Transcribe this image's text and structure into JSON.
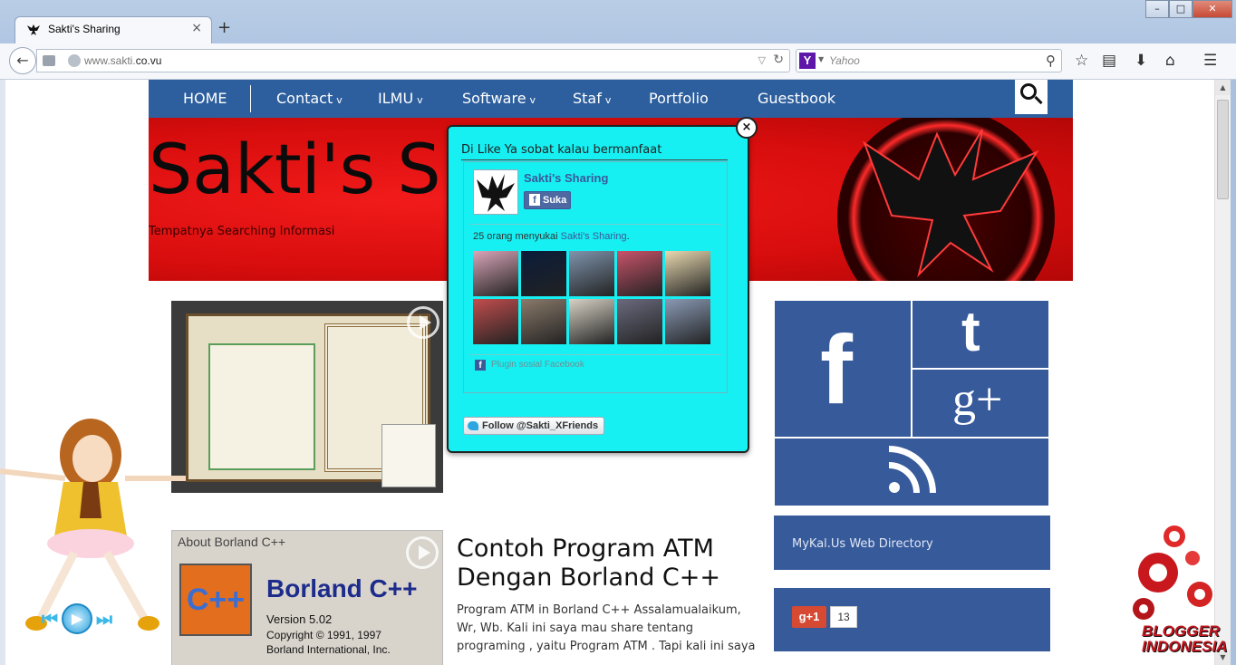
{
  "browser": {
    "tab_title": "Sakti's Sharing",
    "tab_close": "×",
    "new_tab": "+",
    "url_prefix": "www.sakti.",
    "url_domain": "co.vu",
    "search_engine": "Yahoo",
    "window_controls": {
      "minimize": "–",
      "maximize": "□",
      "close": "✕"
    }
  },
  "nav": {
    "items": [
      {
        "label": "HOME",
        "caret": ""
      },
      {
        "label": "Contact",
        "caret": "v"
      },
      {
        "label": "ILMU",
        "caret": "v"
      },
      {
        "label": "Software",
        "caret": "v"
      },
      {
        "label": "Staf",
        "caret": "v"
      },
      {
        "label": "Portfolio",
        "caret": ""
      },
      {
        "label": "Guestbook",
        "caret": ""
      }
    ]
  },
  "header": {
    "title": "Sakti's S",
    "tagline": "Tempatnya Searching Informasi"
  },
  "popup": {
    "heading": "Di Like Ya sobat kalau bermanfaat",
    "page_name": "Sakti's Sharing",
    "like_button": "Suka",
    "likes_prefix": "25 orang menyukai ",
    "likes_page": "Sakti's Sharing",
    "likes_suffix": ".",
    "plugin_text": "Plugin sosial Facebook",
    "follow_button": "Follow @Sakti_XFriends",
    "close": "×",
    "faces": [
      "#d9a5b8",
      "#0a1c3a",
      "#7f94ad",
      "#c9536a",
      "#e9d9b0",
      "#c24d4d",
      "#8a7a6a",
      "#d7d2c5",
      "#6a6a7e",
      "#8a9ab5"
    ]
  },
  "post2": {
    "thumb_caption": "About Borland C++",
    "thumb_logo": "C++",
    "thumb_brand": "Borland C++",
    "thumb_version": "Version 5.02",
    "thumb_copyright1": "Copyright © 1991, 1997",
    "thumb_copyright2": "Borland International, Inc.",
    "title": "Contoh Program ATM Dengan Borland C++",
    "excerpt": "Program ATM in Borland C++ Assalamualaikum, Wr, Wb. Kali ini saya mau share tentang programing , yaitu Program ATM . Tapi kali ini saya"
  },
  "sidebar": {
    "social": {
      "facebook_glyph": "f",
      "twitter_glyph": "t",
      "googleplus_glyph": "g+"
    },
    "directory_link": "MyKal.Us Web Directory",
    "gplus_button": "g+1",
    "gplus_count": "13"
  },
  "player": {
    "prev": "⏮",
    "play": "▶",
    "next": "⏭"
  },
  "badge": {
    "line1": "BLOGGER",
    "line2": "INDONESIA"
  },
  "colors": {
    "nav_blue": "#2d5f9e",
    "banner_red": "#e0120f",
    "popup_cyan": "#16f0f2",
    "tile_blue": "#375a9b"
  }
}
